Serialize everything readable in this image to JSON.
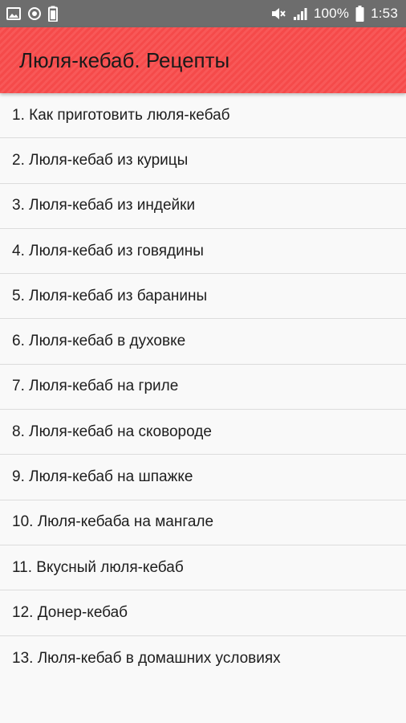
{
  "status_bar": {
    "left_icons": [
      "image-icon",
      "sync-icon",
      "battery-saver-icon"
    ],
    "battery_percent": "100%",
    "time": "1:53"
  },
  "app_bar": {
    "title": "Люля-кебаб. Рецепты"
  },
  "recipes": [
    "1. Как приготовить люля-кебаб",
    "2. Люля-кебаб из курицы",
    "3. Люля-кебаб из индейки",
    "4. Люля-кебаб из говядины",
    "5. Люля-кебаб из баранины",
    "6. Люля-кебаб в духовке",
    "7. Люля-кебаб на гриле",
    "8. Люля-кебаб на сковороде",
    "9. Люля-кебаб на шпажке",
    "10. Люля-кебаба на мангале",
    "11. Вкусный люля-кебаб",
    "12. Донер-кебаб",
    "13. Люля-кебаб в домашних условиях"
  ],
  "colors": {
    "app_bar": "#f54a4a",
    "status_bar": "#6d6d6d"
  }
}
